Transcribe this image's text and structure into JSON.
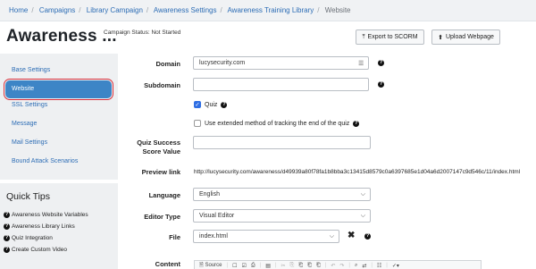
{
  "breadcrumb": {
    "items": [
      "Home",
      "Campaigns",
      "Library Campaign",
      "Awareness Settings",
      "Awareness Training Library"
    ],
    "current": "Website"
  },
  "header": {
    "title": "Awareness ...",
    "status": "Campaign Status:  Not Started",
    "export_label": "Export to SCORM",
    "upload_label": "Upload Webpage"
  },
  "sidebar": {
    "items": [
      {
        "label": "Base Settings"
      },
      {
        "label": "Website"
      },
      {
        "label": "SSL Settings"
      },
      {
        "label": "Message"
      },
      {
        "label": "Mail Settings"
      },
      {
        "label": "Bound Attack Scenarios"
      }
    ]
  },
  "tips": {
    "title": "Quick Tips",
    "items": [
      "Awareness Website Variables",
      "Awareness Library Links",
      "Quiz Integration",
      "Create Custom Video"
    ]
  },
  "form": {
    "domain_label": "Domain",
    "domain_value": "lucysecurity.com",
    "subdomain_label": "Subdomain",
    "subdomain_value": "",
    "quiz_label": "Quiz",
    "quiz_checked": true,
    "extended_label": "Use extended method of tracking the end of the quiz",
    "extended_checked": false,
    "quiz_score_label_1": "Quiz Success",
    "quiz_score_label_2": "Score Value",
    "quiz_score_value": "",
    "preview_label": "Preview link",
    "preview_url": "http://lucysecurity.com/awareness/d49939a80f78fa1b8bba3c13415d8579c0a6397685e1d04a6d2007147c9d546c/11/index.html",
    "language_label": "Language",
    "language_value": "English",
    "editor_label": "Editor Type",
    "editor_value": "Visual Editor",
    "file_label": "File",
    "file_value": "index.html",
    "content_label": "Content",
    "toolbar_source": "Source"
  }
}
